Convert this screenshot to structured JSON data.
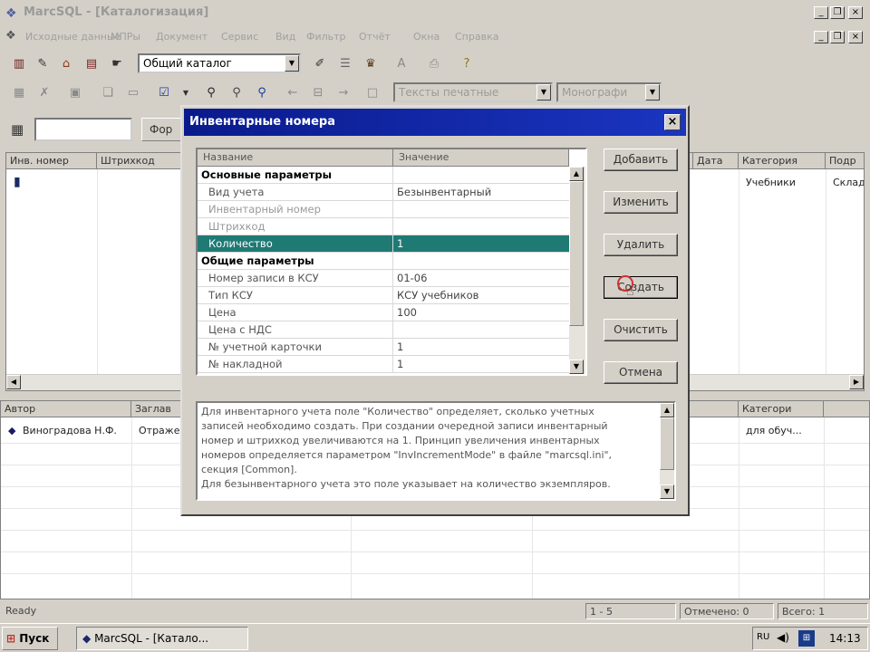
{
  "window": {
    "title": "MarcSQL - [Каталогизация]"
  },
  "menu": {
    "items": [
      "Исходные данные",
      "МПРы",
      "Документ",
      "Сервис",
      "Вид",
      "Фильтр",
      "Отчёт",
      "Окна",
      "Справка"
    ]
  },
  "toolbar1": {
    "catalog_combo": "Общий каталог"
  },
  "toolbar2": {
    "material_combo": "Тексты печатные",
    "type_combo": "Монографи"
  },
  "left_panel": {
    "form_button": "Фор",
    "top_grid": {
      "columns": [
        "Инв. номер",
        "Штрихкод"
      ],
      "right_columns": [
        "Дата",
        "Категория",
        "Подр"
      ],
      "row": {
        "category": "Учебники",
        "subdivision": "Склад"
      }
    },
    "bottom_grid": {
      "columns": [
        "Автор",
        "Заглав"
      ],
      "right_columns": [
        "Категори"
      ],
      "row": {
        "author": "Виноградова Н.Ф.",
        "title": "Отраже",
        "category": "для обуч..."
      }
    }
  },
  "dialog": {
    "title": "Инвентарные номера",
    "close": "×",
    "table": {
      "headers": {
        "name": "Название",
        "value": "Значение"
      },
      "rows": [
        {
          "name": "Основные параметры",
          "value": "",
          "group": true
        },
        {
          "name": "Вид учета",
          "value": "Безынвентарный"
        },
        {
          "name": "Инвентарный номер",
          "value": "",
          "dim": true
        },
        {
          "name": "Штрихкод",
          "value": "",
          "dim": true
        },
        {
          "name": "Количество",
          "value": "1",
          "selected": true
        },
        {
          "name": "Общие параметры",
          "value": "",
          "group": true
        },
        {
          "name": "Номер записи в КСУ",
          "value": "01-06"
        },
        {
          "name": "Тип КСУ",
          "value": "КСУ учебников"
        },
        {
          "name": "Цена",
          "value": "100"
        },
        {
          "name": "Цена с НДС",
          "value": ""
        },
        {
          "name": "№ учетной карточки",
          "value": "1"
        },
        {
          "name": "№ накладной",
          "value": "1"
        }
      ]
    },
    "buttons": {
      "add": "Добавить",
      "change": "Изменить",
      "delete": "Удалить",
      "create": "Создать",
      "clear": "Очистить",
      "cancel": "Отмена"
    },
    "description": [
      "Для инвентарного учета поле \"Количество\" определяет, сколько учетных",
      "записей необходимо создать. При создании очередной записи инвентарный",
      "номер и штрихкод увеличиваются на 1. Принцип увеличения инвентарных",
      "номеров определяется параметром \"InvIncrementMode\" в файле \"marcsql.ini\",",
      "секция [Common].",
      "Для безынвентарного учета это поле указывает на количество экземпляров."
    ]
  },
  "statusbar": {
    "ready": "Ready",
    "page": "1 - 5",
    "marked": "Отмечено: 0",
    "total": "Всего: 1"
  },
  "taskbar": {
    "start": "Пуск",
    "task": "MarcSQL - [Катало...",
    "clock": "14:13"
  }
}
